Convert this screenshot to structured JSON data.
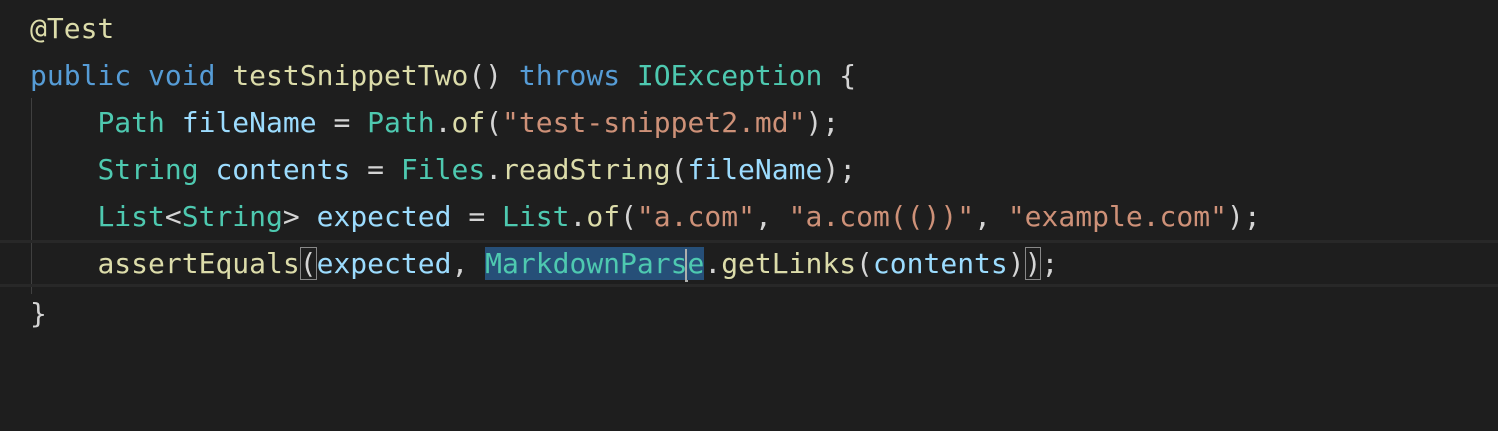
{
  "editor": {
    "lines": [
      {
        "tokens": [
          "@Test"
        ]
      },
      {
        "tokens": [
          "public",
          " ",
          "void",
          " ",
          "testSnippetTwo",
          "()",
          " ",
          "throws",
          " ",
          "IOException",
          " {"
        ]
      },
      {
        "tokens": [
          "Path",
          " ",
          "fileName",
          " = ",
          "Path",
          ".",
          "of",
          "(",
          "\"test-snippet2.md\"",
          ");"
        ]
      },
      {
        "tokens": [
          "String",
          " ",
          "contents",
          " = ",
          "Files",
          ".",
          "readString",
          "(",
          "fileName",
          ");"
        ]
      },
      {
        "tokens": [
          "List",
          "<",
          "String",
          "> ",
          "expected",
          " = ",
          "List",
          ".",
          "of",
          "(",
          "\"a.com\"",
          ", ",
          "\"a.com(())\"",
          ", ",
          "\"example.com\"",
          ");"
        ]
      },
      {
        "tokens": [
          "assertEquals",
          "(",
          "expected",
          ", ",
          "MarkdownPars",
          "e",
          ".",
          "getLinks",
          "(",
          "contents",
          ")",
          ")",
          ";"
        ]
      },
      {
        "tokens": [
          "}"
        ]
      }
    ],
    "indent": "    ",
    "selected_text": "MarkdownPars",
    "colors": {
      "background": "#1e1e1e",
      "keyword": "#569cd6",
      "type": "#4ec9b0",
      "variable": "#9cdcfe",
      "function": "#dcdcaa",
      "string": "#ce9178",
      "punctuation": "#d4d4d4",
      "selection": "#264f78"
    }
  }
}
